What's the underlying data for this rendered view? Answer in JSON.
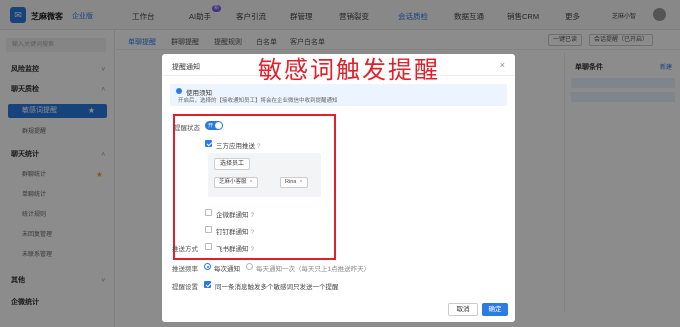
{
  "app": {
    "logo_glyph": "✉",
    "brand": "芝麻微客",
    "brand_tag": "企业版",
    "nav": [
      "工作台",
      "AI助手",
      "客户引流",
      "群管理",
      "营销裂变",
      "会话质检",
      "数据互通",
      "销售CRM",
      "更多"
    ],
    "nav_badge": "新",
    "active_nav": "会话质检",
    "account_name": "芝麻小智"
  },
  "sidebar": {
    "search_placeholder": "输入关键词搜索",
    "items": [
      {
        "label": "风险监控",
        "type": "group",
        "caret": "˅"
      },
      {
        "label": "聊天质检",
        "type": "group",
        "caret": "˄"
      },
      {
        "label": "敏感词提醒",
        "type": "active"
      },
      {
        "label": "群规提醒",
        "type": "sub"
      },
      {
        "label": "聊天统计",
        "type": "group",
        "caret": "˄"
      },
      {
        "label": "群聊统计",
        "type": "sub"
      },
      {
        "label": "单聊统计",
        "type": "sub"
      },
      {
        "label": "统计规则",
        "type": "sub"
      },
      {
        "label": "未回复管理",
        "type": "sub"
      },
      {
        "label": "未联系管理",
        "type": "sub"
      },
      {
        "label": "其他",
        "type": "group",
        "caret": "˅"
      },
      {
        "label": "企微统计",
        "type": "group"
      }
    ]
  },
  "main": {
    "tabs": [
      "单聊提醒",
      "群聊提醒",
      "提醒规则",
      "白名单",
      "客户白名单"
    ],
    "active_tab": "单聊提醒",
    "right_buttons": [
      "一键已读",
      "会话提醒（已开启）"
    ],
    "right_panel_title": "单聊条件",
    "right_panel_new": "新建"
  },
  "modal": {
    "title": "提醒通知",
    "annotation": "敏感词触发提醒",
    "close": "×",
    "info_title": "使用须知",
    "info_desc": "开启后，选择的【接收通知员工】将会在企业微信中收到提醒通知",
    "notify_status_label": "提醒状态",
    "toggle_text": "开",
    "options": {
      "app_push": "三方应用推送",
      "pick_staff": "选择员工",
      "staff_tags": [
        "芝麻小客服",
        "Rina"
      ],
      "tag_close": "×",
      "wecom_group": "企微群通知",
      "dingtalk_group": "钉钉群通知",
      "feishu_group": "飞书群通知"
    },
    "push_method_label": "推送方式",
    "frequency_label": "推送频率",
    "frequency_options": [
      "每次通知",
      "每天通知一次（每天只上1点推送昨天）"
    ],
    "setting_label": "提醒设置",
    "setting_text": "同一条消息触发多个敏感词只发送一个提醒",
    "help_glyph": "?",
    "cancel": "取消",
    "ok": "确定"
  },
  "colors": {
    "accent": "#2b7be4",
    "annotation_red": "#e0202a"
  }
}
